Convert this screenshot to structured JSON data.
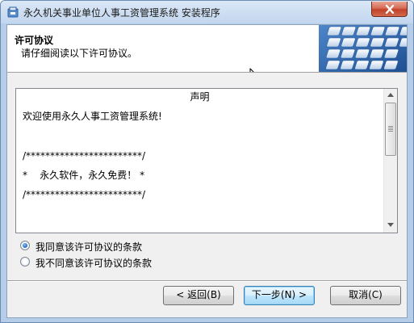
{
  "window": {
    "title": "永久机关事业单位人事工资管理系统 安装程序"
  },
  "header": {
    "title": "许可协议",
    "subtitle": "请仔细阅读以下许可协议。"
  },
  "license": {
    "heading": "声明",
    "welcome": "欢迎使用永久人事工资管理系统!",
    "border_top": "/************************/",
    "slogan": "*    永久软件，永久免费！ *",
    "border_bottom": "/************************/"
  },
  "options": {
    "accept_label": "我同意该许可协议的条款",
    "decline_label": "我不同意该许可协议的条款",
    "selected": "accept"
  },
  "buttons": {
    "back": "< 返回(B)",
    "next": "下一步(N) >",
    "cancel": "取消(C)"
  },
  "colors": {
    "selected_radio": "#2a74c6",
    "default_button_border": "#3c7fb1",
    "close_button": "#c2412a"
  },
  "icons": {
    "app": "installer-app-icon",
    "close": "close-icon",
    "header": "keyboard-image",
    "cursor": "mouse-cursor-icon"
  }
}
